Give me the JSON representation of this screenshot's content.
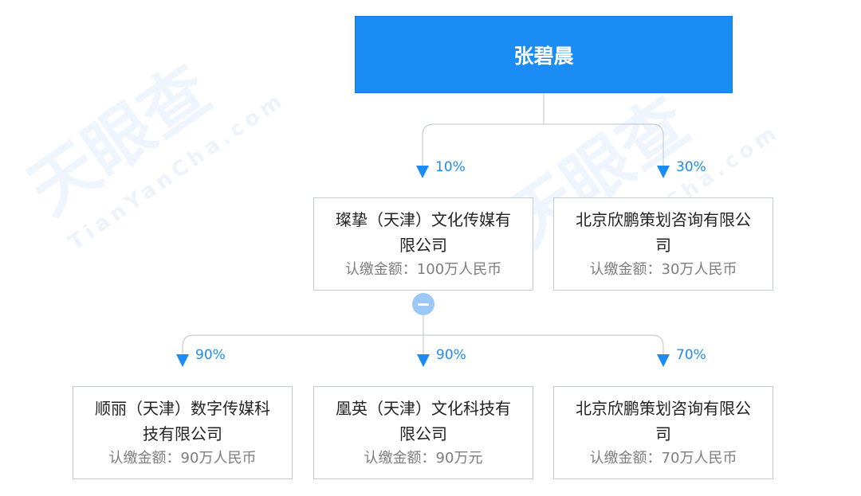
{
  "watermark": {
    "brand": "天眼查",
    "domain": "TianYanCha.com"
  },
  "root": {
    "name": "张碧晨"
  },
  "level1": [
    {
      "percent": "10%",
      "name_line1": "璨挚（天津）文化传媒有",
      "name_line2": "限公司",
      "amount": "认缴金额：100万人民币"
    },
    {
      "percent": "30%",
      "name_line1": "北京欣鹏策划咨询有限公",
      "name_line2": "司",
      "amount": "认缴金额：30万人民币"
    }
  ],
  "level2": [
    {
      "percent": "90%",
      "name_line1": "顺丽（天津）数字传媒科",
      "name_line2": "技有限公司",
      "amount": "认缴金额：90万人民币"
    },
    {
      "percent": "90%",
      "name_line1": "凰英（天津）文化科技有",
      "name_line2": "限公司",
      "amount": "认缴金额：90万元"
    },
    {
      "percent": "70%",
      "name_line1": "北京欣鹏策划咨询有限公",
      "name_line2": "司",
      "amount": "认缴金额：70万人民币"
    }
  ],
  "colors": {
    "accent": "#1a8cf4",
    "border": "#c7ccd3",
    "line": "#c9cdd2",
    "toggle": "#9cc8f5"
  },
  "icons": {
    "collapse": "minus-circle-icon",
    "arrow": "triangle-down-icon"
  }
}
